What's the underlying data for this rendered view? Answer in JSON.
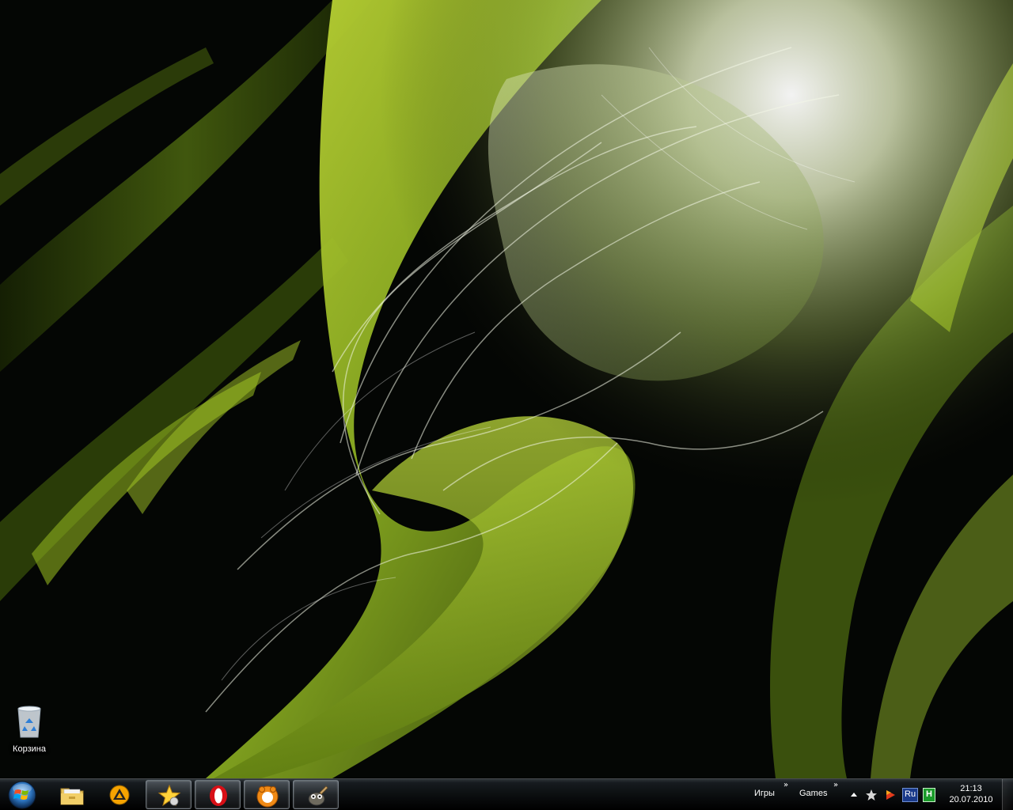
{
  "desktop": {
    "icons": [
      {
        "label": "Корзина",
        "icon": "recycle-bin-icon"
      }
    ]
  },
  "taskbar": {
    "start_icon": "windows-logo-icon",
    "pinned": [
      {
        "name": "explorer",
        "icon": "folder-icon",
        "active": false
      },
      {
        "name": "aimp",
        "icon": "aimp-triangle-icon",
        "active": false
      },
      {
        "name": "favorites",
        "icon": "star-icon",
        "active": true
      },
      {
        "name": "opera",
        "icon": "opera-icon",
        "active": true
      },
      {
        "name": "gom-player",
        "icon": "gom-player-icon",
        "active": true
      },
      {
        "name": "gimp",
        "icon": "gimp-icon",
        "active": true
      }
    ],
    "toolbars": [
      {
        "label": "Игры"
      },
      {
        "label": "Games"
      }
    ],
    "tray": {
      "icons": [
        "show-hidden-icons-arrow",
        "star-tray-icon",
        "media-player-tray-icon",
        "language-indicator-icon",
        "green-status-icon"
      ],
      "language": "Ru",
      "green_badge": "H"
    },
    "clock": {
      "time": "21:13",
      "date": "20.07.2010"
    }
  },
  "colors": {
    "wallpaper_green": "#9fc21c",
    "wallpaper_light": "#e8f0d0",
    "taskbar": "#0a0c0e"
  }
}
